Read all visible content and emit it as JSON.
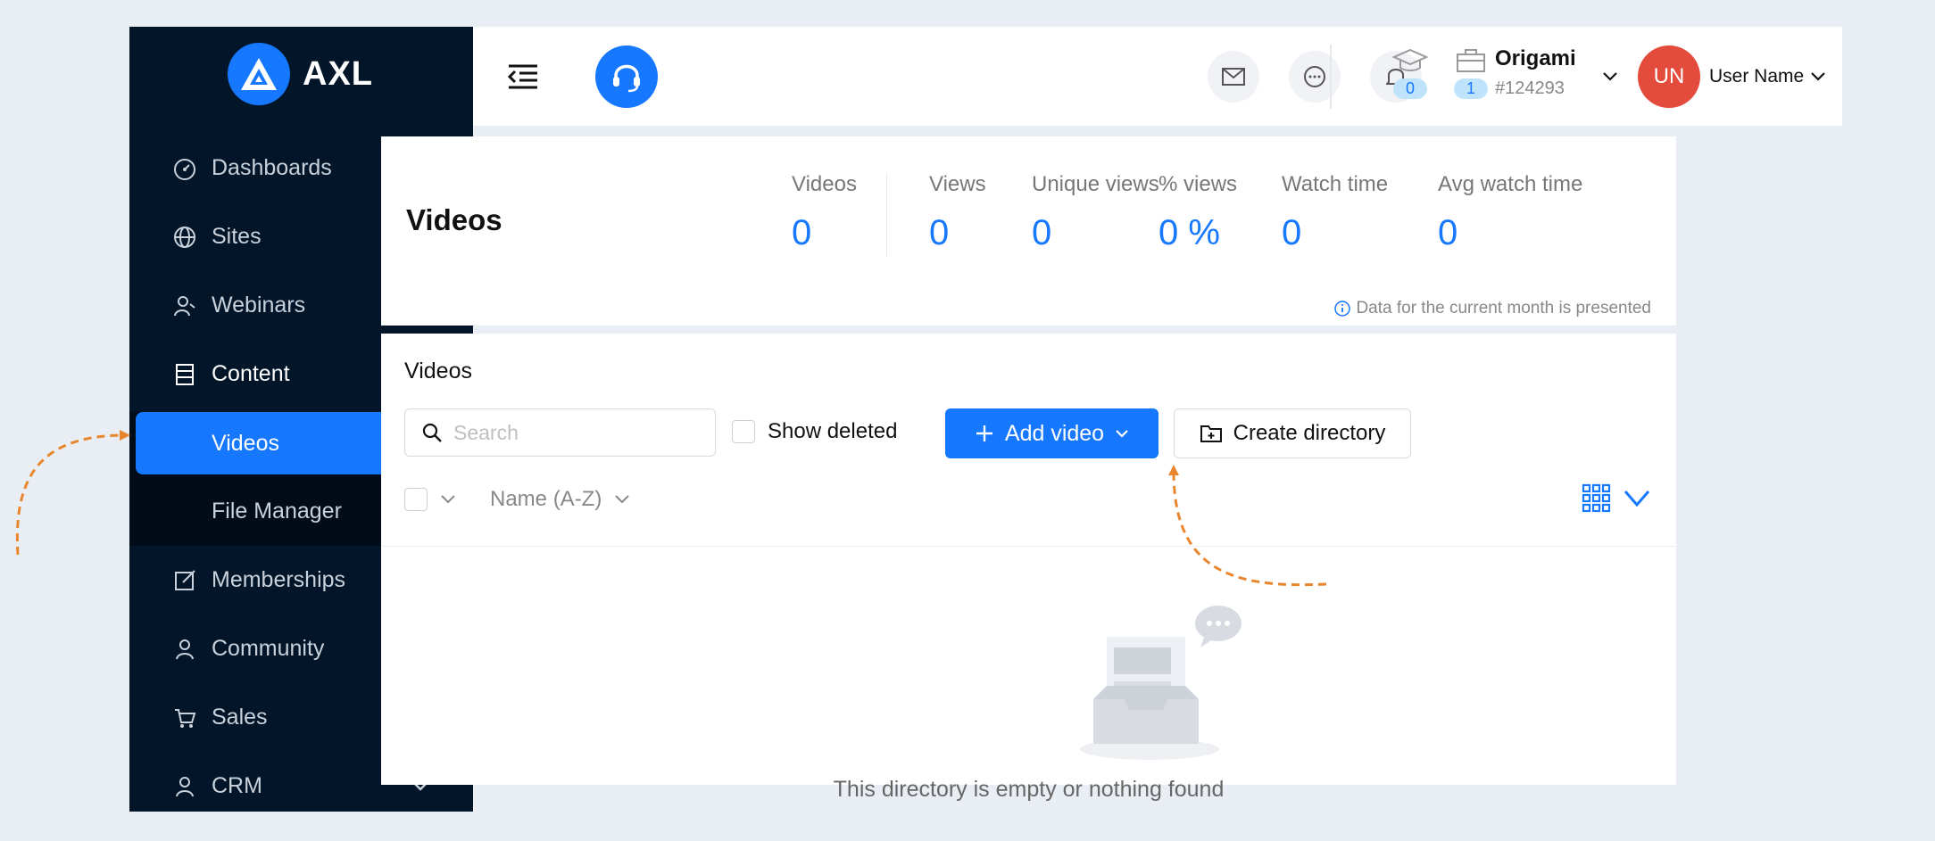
{
  "brand": {
    "name": "AXL"
  },
  "sidebar": {
    "items": [
      {
        "label": "Dashboards",
        "icon": "dashboard-icon",
        "expandable": false
      },
      {
        "label": "Sites",
        "icon": "globe-icon",
        "expandable": true
      },
      {
        "label": "Webinars",
        "icon": "webinar-icon",
        "expandable": true
      },
      {
        "label": "Content",
        "icon": "content-icon",
        "expandable": true,
        "expanded": true
      },
      {
        "label": "Memberships",
        "icon": "edit-icon",
        "expandable": true
      },
      {
        "label": "Community",
        "icon": "user-icon",
        "expandable": false
      },
      {
        "label": "Sales",
        "icon": "cart-icon",
        "expandable": true
      },
      {
        "label": "CRM",
        "icon": "user-icon",
        "expandable": true
      }
    ],
    "content_sub": [
      {
        "label": "Videos",
        "active": true
      },
      {
        "label": "File Manager",
        "active": false
      }
    ]
  },
  "header": {
    "courses_count": "0",
    "briefcase_count": "1",
    "org_name": "Origami",
    "org_id": "#124293",
    "avatar_initials": "UN",
    "user_name": "User Name"
  },
  "stats": {
    "title": "Videos",
    "items": [
      {
        "label": "Videos",
        "value": "0"
      },
      {
        "label": "Views",
        "value": "0"
      },
      {
        "label": "Unique views",
        "value": "0"
      },
      {
        "label": "% views",
        "value": "0 %"
      },
      {
        "label": "Watch time",
        "value": "0"
      },
      {
        "label": "Avg watch time",
        "value": "0"
      }
    ],
    "note": "Data for the current month is presented"
  },
  "list": {
    "title": "Videos",
    "search_placeholder": "Search",
    "show_deleted_label": "Show deleted",
    "add_video_label": "Add video",
    "create_directory_label": "Create directory",
    "sort_label": "Name (A-Z)",
    "empty_text": "This directory is empty or nothing found"
  },
  "colors": {
    "accent": "#1677ff",
    "sidebar_bg": "#021529",
    "avatar_bg": "#e34c3c",
    "annotation": "#e8862e"
  }
}
